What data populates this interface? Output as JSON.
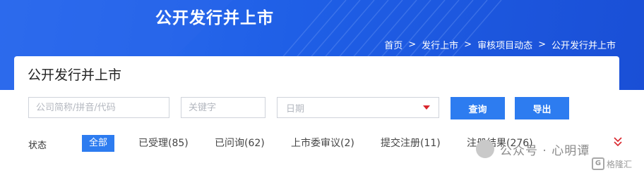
{
  "banner": {
    "title": "公开发行并上市"
  },
  "breadcrumb": {
    "items": [
      "首页",
      "发行上市",
      "审核项目动态",
      "公开发行并上市"
    ],
    "separator": ">"
  },
  "card": {
    "title": "公开发行并上市"
  },
  "search": {
    "name_placeholder": "公司简称/拼音/代码",
    "keyword_placeholder": "关键字",
    "date_placeholder": "日期",
    "query_label": "查询",
    "export_label": "导出"
  },
  "status": {
    "label": "状态",
    "tabs": [
      {
        "label": "全部",
        "active": true
      },
      {
        "label": "已受理(85)",
        "active": false
      },
      {
        "label": "已问询(62)",
        "active": false
      },
      {
        "label": "上市委审议(2)",
        "active": false
      },
      {
        "label": "提交注册(11)",
        "active": false
      },
      {
        "label": "注册结果(276)",
        "active": false
      }
    ]
  },
  "watermark": {
    "text": "公众号 · 心明谭",
    "badge": "格隆汇"
  },
  "colors": {
    "banner": "#1f5fe6",
    "primary_button": "#2d7cf0",
    "caret": "#d9262c"
  }
}
